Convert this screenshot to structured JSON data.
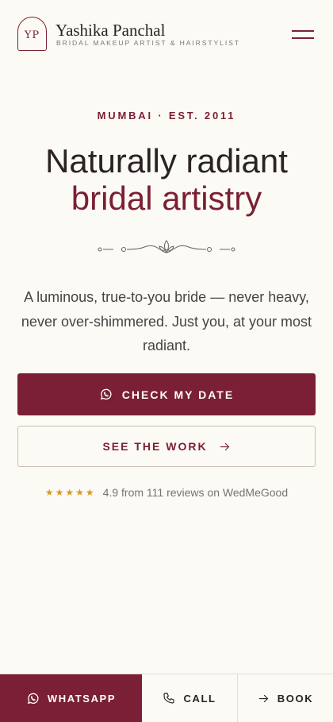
{
  "header": {
    "monogram": "YP",
    "name": "Yashika Panchal",
    "tagline": "BRIDAL MAKEUP ARTIST & HAIRSTYLIST",
    "menu_icon": "hamburger-menu-icon"
  },
  "hero": {
    "eyebrow": "MUMBAI · EST. 2011",
    "title_line1": "Naturally radiant",
    "title_line2": "bridal artistry",
    "ornament_icon": "floral-divider-icon",
    "lede": "A luminous, true-to-you bride — never heavy, never over-shimmered. Just you, at your most radiant."
  },
  "cta": {
    "primary_label": "CHECK MY DATE",
    "primary_icon": "whatsapp-icon",
    "secondary_label": "SEE THE WORK",
    "secondary_icon": "arrow-right-icon"
  },
  "rating": {
    "stars": "★★★★★",
    "stars_value": 5,
    "text": "4.9 from 111 reviews on WedMeGood"
  },
  "bottom_bar": {
    "whatsapp": "WHATSAPP",
    "call": "CALL",
    "book": "BOOK"
  },
  "colors": {
    "accent": "#7a1f35",
    "background": "#fcfaf4",
    "star": "#d49a2a"
  }
}
